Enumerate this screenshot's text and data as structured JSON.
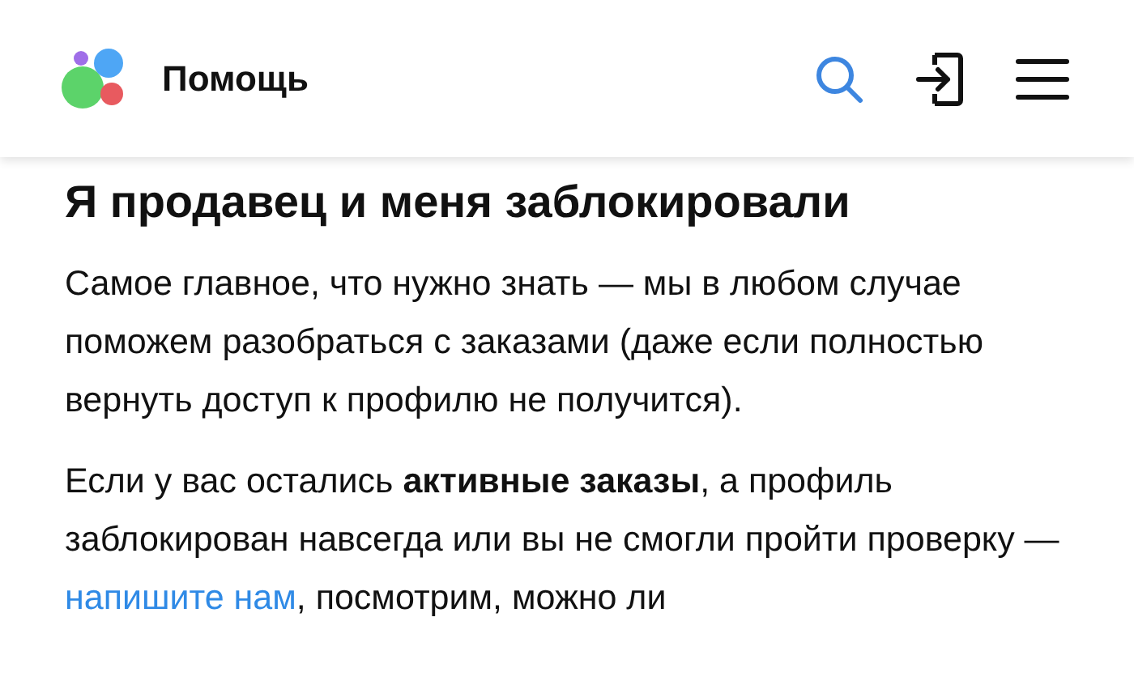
{
  "header": {
    "title": "Помощь"
  },
  "article": {
    "heading": "Я продавец и меня заблокировали",
    "paragraphs": [
      {
        "parts": [
          {
            "kind": "text",
            "text": "Самое главное, что нужно знать — мы в любом случае поможем разобраться с заказами (даже если полностью вернуть доступ к профилю не получится)."
          }
        ]
      },
      {
        "parts": [
          {
            "kind": "text",
            "text": "Если у вас остались **активные заказы**, а профиль заблокирован навсегда или вы не смогли пройти проверку — "
          },
          {
            "kind": "link",
            "text": "напишите нам"
          },
          {
            "kind": "text",
            "text": ", посмотрим, можно ли"
          }
        ]
      }
    ]
  }
}
